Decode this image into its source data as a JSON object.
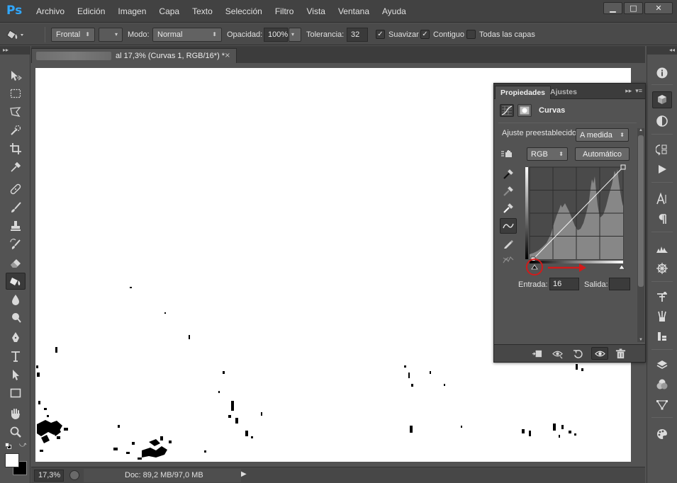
{
  "app": {
    "logo": "Ps"
  },
  "menu": [
    "Archivo",
    "Edición",
    "Imagen",
    "Capa",
    "Texto",
    "Selección",
    "Filtro",
    "Vista",
    "Ventana",
    "Ayuda"
  ],
  "options": {
    "fill_source": "Frontal",
    "mode_label": "Modo:",
    "mode_value": "Normal",
    "opacity_label": "Opacidad:",
    "opacity_value": "100%",
    "tolerance_label": "Tolerancia:",
    "tolerance_value": "32",
    "antialias_label": "Suavizar",
    "antialias_checked": true,
    "contiguous_label": "Contiguo",
    "contiguous_checked": true,
    "all_layers_label": "Todas las capas",
    "all_layers_checked": false
  },
  "document": {
    "tab_title": "al 17,3% (Curvas 1, RGB/16*) *",
    "close": "×"
  },
  "status": {
    "zoom": "17,3%",
    "doc": "Doc: 89,2 MB/97,0 MB"
  },
  "properties": {
    "tab_active": "Propiedades",
    "tab_other": "Ajustes",
    "title": "Curvas",
    "preset_label": "Ajuste preestablecido:",
    "preset_value": "A medida",
    "channel": "RGB",
    "auto_button": "Automático",
    "input_label": "Entrada:",
    "input_value": "16",
    "output_label": "Salida:",
    "output_value": ""
  },
  "colors": {
    "annotation_red": "#d21a1a",
    "ps_blue": "#31a8ff"
  }
}
